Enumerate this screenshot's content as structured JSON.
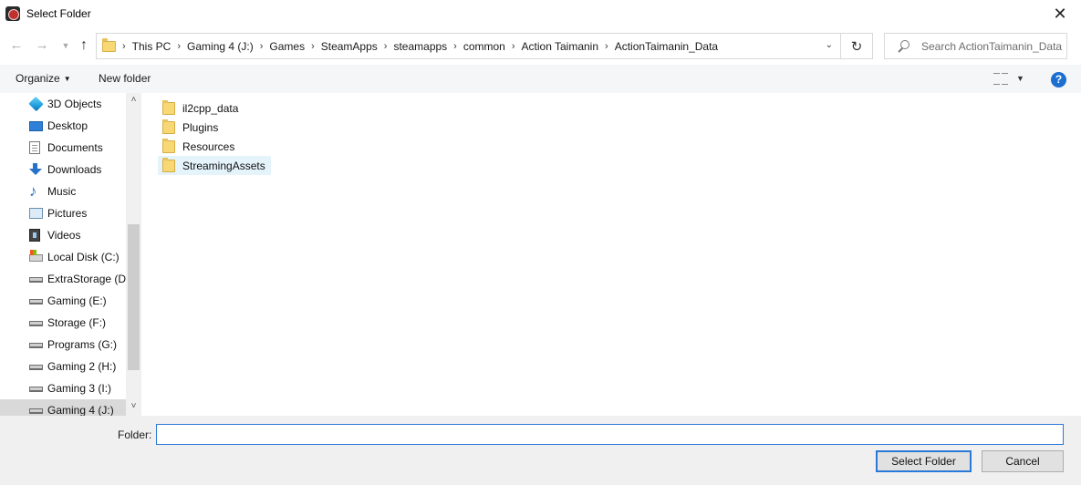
{
  "window": {
    "title": "Select Folder"
  },
  "address": {
    "crumbs": [
      "This PC",
      "Gaming 4 (J:)",
      "Games",
      "SteamApps",
      "steamapps",
      "common",
      "Action Taimanin",
      "ActionTaimanin_Data"
    ]
  },
  "search": {
    "placeholder": "Search ActionTaimanin_Data"
  },
  "toolbar": {
    "organize": "Organize",
    "new_folder": "New folder",
    "help": "?"
  },
  "nav": {
    "items": [
      {
        "label": "3D Objects",
        "icon": "3d-objects-icon"
      },
      {
        "label": "Desktop",
        "icon": "desktop-icon"
      },
      {
        "label": "Documents",
        "icon": "documents-icon"
      },
      {
        "label": "Downloads",
        "icon": "downloads-icon"
      },
      {
        "label": "Music",
        "icon": "music-icon"
      },
      {
        "label": "Pictures",
        "icon": "pictures-icon"
      },
      {
        "label": "Videos",
        "icon": "videos-icon"
      },
      {
        "label": "Local Disk (C:)",
        "icon": "local-disk-icon"
      },
      {
        "label": "ExtraStorage (D:)",
        "icon": "drive-icon"
      },
      {
        "label": "Gaming (E:)",
        "icon": "drive-icon"
      },
      {
        "label": "Storage (F:)",
        "icon": "drive-icon"
      },
      {
        "label": "Programs (G:)",
        "icon": "drive-icon"
      },
      {
        "label": "Gaming 2 (H:)",
        "icon": "drive-icon"
      },
      {
        "label": "Gaming 3 (I:)",
        "icon": "drive-icon"
      },
      {
        "label": "Gaming 4 (J:)",
        "icon": "drive-icon",
        "selected": true
      }
    ]
  },
  "files": [
    {
      "name": "il2cpp_data",
      "icon": "folder-icon"
    },
    {
      "name": "Plugins",
      "icon": "folder-icon"
    },
    {
      "name": "Resources",
      "icon": "folder-icon"
    },
    {
      "name": "StreamingAssets",
      "icon": "folder-icon",
      "selected": true
    }
  ],
  "bottom": {
    "folder_label": "Folder:",
    "folder_value": "",
    "select_button": "Select Folder",
    "cancel_button": "Cancel"
  }
}
